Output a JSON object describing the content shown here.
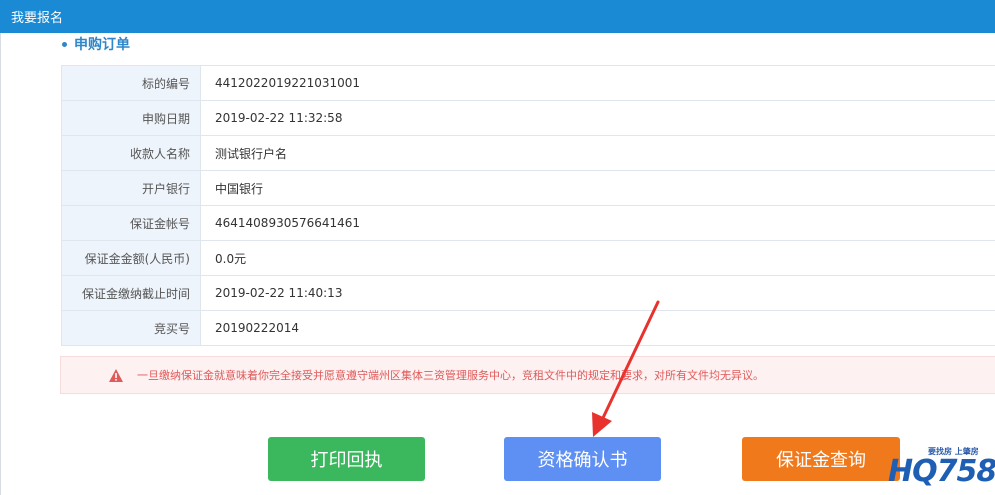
{
  "window": {
    "title": "我要报名"
  },
  "section": {
    "title": "申购订单"
  },
  "order": {
    "rows": [
      {
        "label": "标的编号",
        "value": "4412022019221031001"
      },
      {
        "label": "申购日期",
        "value": "2019-02-22 11:32:58"
      },
      {
        "label": "收款人名称",
        "value": "测试银行户名"
      },
      {
        "label": "开户银行",
        "value": "中国银行"
      },
      {
        "label": "保证金帐号",
        "value": "4641408930576641461"
      },
      {
        "label": "保证金金额(人民币)",
        "value": "0.0元"
      },
      {
        "label": "保证金缴纳截止时间",
        "value": "2019-02-22 11:40:13"
      },
      {
        "label": "竞买号",
        "value": "20190222014"
      }
    ]
  },
  "notice": {
    "icon": "warning-icon",
    "text": "一旦缴纳保证金就意味着你完全接受并愿意遵守端州区集体三资管理服务中心，竞租文件中的规定和要求，对所有文件均无异议。"
  },
  "actions": {
    "print_label": "打印回执",
    "certificate_label": "资格确认书",
    "deposit_query_label": "保证金查询"
  },
  "logo": {
    "slogan": "要找房 上肇房",
    "mark": "HQ758"
  },
  "colors": {
    "titlebar": "#1a8ad4",
    "accent": "#2f86c8",
    "print_button": "#3bb85e",
    "certificate_button": "#5e8ff2",
    "query_button": "#f07a1b",
    "warning_text": "#e05a5a",
    "annotation_arrow": "#e8322e"
  }
}
